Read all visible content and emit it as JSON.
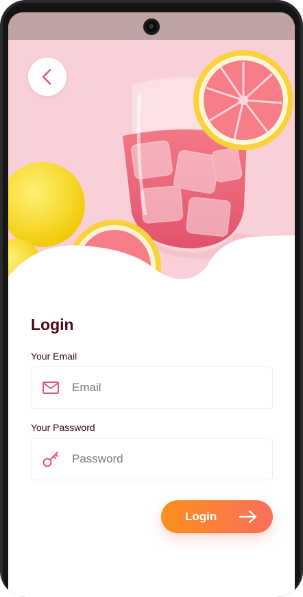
{
  "screen": {
    "title": "Login",
    "back_icon": "chevron-left-icon",
    "hero_image": "pink-lemonade-glass-with-grapefruit-and-lemons"
  },
  "form": {
    "email": {
      "label": "Your Email",
      "placeholder": "Email",
      "value": "",
      "icon": "mail-icon"
    },
    "password": {
      "label": "Your Password",
      "placeholder": "Password",
      "value": "",
      "icon": "key-icon"
    }
  },
  "login_button": {
    "label": "Login",
    "icon": "arrow-right-icon"
  },
  "colors": {
    "accent_start": "#fb8f1c",
    "accent_end": "#fb6f5b",
    "icon_pink": "#e8546f",
    "title_dark": "#4a0a14",
    "hero_background": "#fbd5dc"
  }
}
